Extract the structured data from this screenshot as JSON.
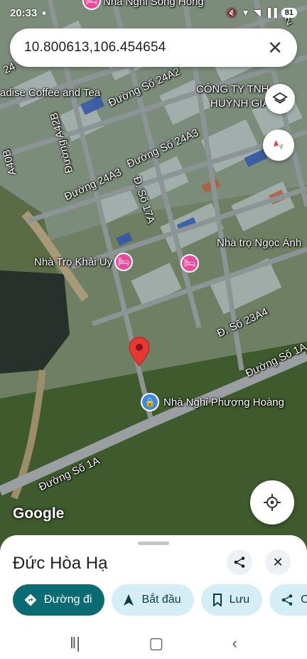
{
  "status_bar": {
    "time": "20:33",
    "battery": "81"
  },
  "search": {
    "query": "10.800613,106.454654",
    "close_icon": "close-icon"
  },
  "map": {
    "labels": {
      "top_place": "Nhà Nghỉ Sông Hồng",
      "paradise": "adise Coffee and Tea",
      "company_l1": "CÔNG TY TNH",
      "company_l2": "HUỲNH GIA",
      "road_24a2": "Đường Số 24A2",
      "road_24a3a": "Đường Số 24A3",
      "road_24a3b": "Đường 24A3",
      "road_a42b": "Đường A42B",
      "road_a40b": "A40B",
      "road_17a": "Đ. Số 17A",
      "road_24": "24",
      "road_tr": "2",
      "nha_tro_khai_uy": "Nhà Trọ Khải Uy",
      "nha_tro_ngoc_anh": "Nhà trọ Ngọc Ánh",
      "road_23a4": "Đ. Số 23A4",
      "road_1a_right": "Đường Số 1A",
      "nha_nghi_phuong_hoang": "Nhà Nghỉ Phượng Hoàng",
      "road_1a_left": "Đường Số 1A"
    },
    "attribution": "Google"
  },
  "sheet": {
    "title": "Đức Hòa Hạ",
    "actions": [
      {
        "label": "Đường đi",
        "icon": "directions-icon"
      },
      {
        "label": "Bắt đầu",
        "icon": "navigation-arrow-icon"
      },
      {
        "label": "Lưu",
        "icon": "bookmark-icon"
      },
      {
        "label": "C",
        "icon": "share-icon"
      }
    ]
  },
  "colors": {
    "primary_chip": "#0b6b73",
    "secondary_chip": "#d5eef5",
    "pin": "#e53935",
    "poi_lodging": "#e94b9a",
    "poi_hotel": "#3f8ae0"
  }
}
